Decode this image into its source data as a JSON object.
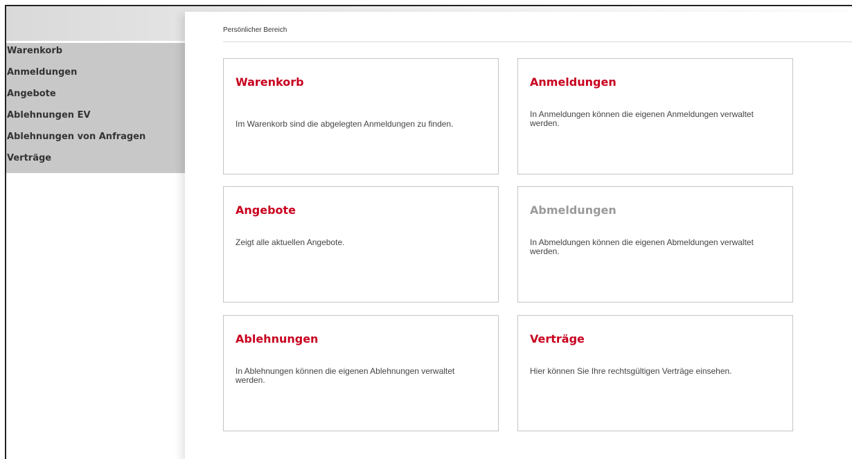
{
  "breadcrumb": "Persönlicher Bereich",
  "sidebar": {
    "items": [
      {
        "label": "Warenkorb"
      },
      {
        "label": "Anmeldungen"
      },
      {
        "label": "Angebote"
      },
      {
        "label": "Ablehnungen EV"
      },
      {
        "label": "Ablehnungen von Anfragen"
      },
      {
        "label": "Verträge"
      }
    ]
  },
  "tiles": [
    {
      "title": "Warenkorb",
      "description": "Im Warenkorb sind die abgelegten Anmeldungen zu finden.",
      "enabled": true
    },
    {
      "title": "Anmeldungen",
      "description": "In Anmeldungen können die eigenen Anmeldungen verwaltet werden.",
      "enabled": true
    },
    {
      "title": "Angebote",
      "description": "Zeigt alle aktuellen Angebote.",
      "enabled": true
    },
    {
      "title": "Abmeldungen",
      "description": "In Abmeldungen können die eigenen Abmeldungen verwaltet werden.",
      "enabled": false
    },
    {
      "title": "Ablehnungen",
      "description": "In Ablehnungen können die eigenen Ablehnungen verwaltet werden.",
      "enabled": true
    },
    {
      "title": "Verträge",
      "description": "Hier können Sie Ihre rechtsgültigen Verträge einsehen.",
      "enabled": true
    }
  ],
  "colors": {
    "accent": "#c8001e",
    "disabled_title": "#9a9a9a",
    "sidebar_bg": "#c8c8c8"
  }
}
